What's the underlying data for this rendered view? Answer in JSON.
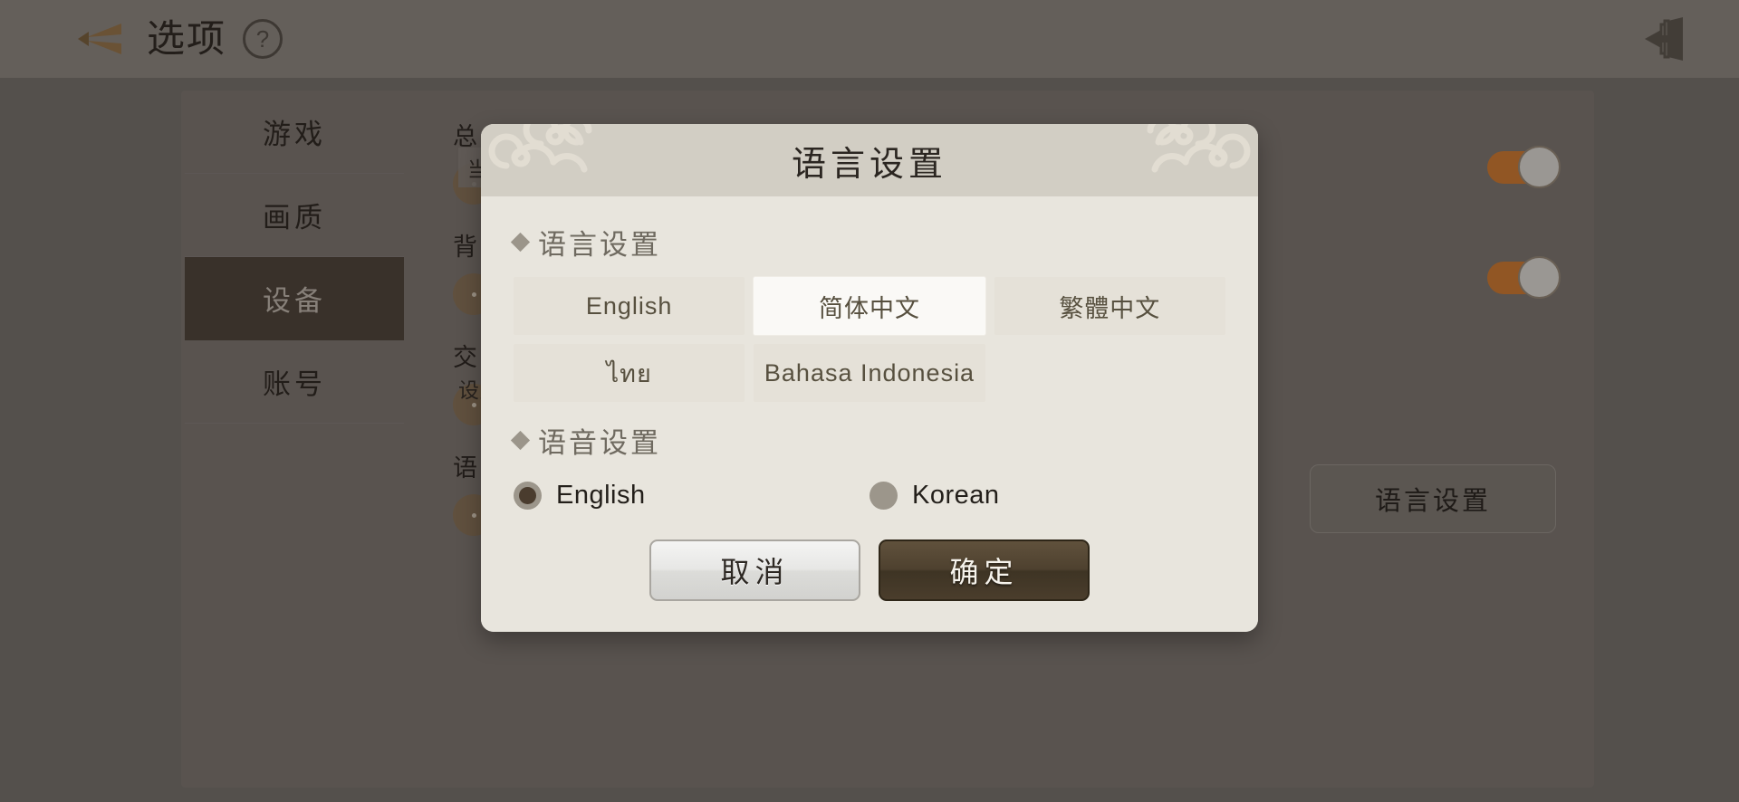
{
  "header": {
    "title": "选项",
    "back_icon": "back-arrow-icon",
    "help_icon": "help-question-icon",
    "exit_icon": "exit-door-icon"
  },
  "sidebar": {
    "items": [
      {
        "label": "游戏",
        "active": false
      },
      {
        "label": "画质",
        "active": false
      },
      {
        "label": "设备",
        "active": true
      },
      {
        "label": "账号",
        "active": false
      }
    ]
  },
  "background_settings": {
    "hidden_labels": [
      "总",
      "背",
      "交",
      "语"
    ],
    "rows": [
      {
        "desc": "当前设备的通知。",
        "toggle_on": true
      },
      {
        "desc": "",
        "toggle_on": true
      },
      {
        "desc": "设置会自动保存。",
        "toggle_on": false
      },
      {
        "button_label": "语言设置"
      }
    ]
  },
  "dialog": {
    "title": "语言设置",
    "language_section": {
      "heading": "语言设置",
      "options": [
        {
          "label": "English",
          "selected": false
        },
        {
          "label": "简体中文",
          "selected": true
        },
        {
          "label": "繁體中文",
          "selected": false
        },
        {
          "label": "ไทย",
          "selected": false
        },
        {
          "label": "Bahasa Indonesia",
          "selected": false
        }
      ]
    },
    "voice_section": {
      "heading": "语音设置",
      "options": [
        {
          "label": "English",
          "selected": true
        },
        {
          "label": "Korean",
          "selected": false
        }
      ]
    },
    "buttons": {
      "cancel": "取消",
      "confirm": "确定"
    }
  },
  "colors": {
    "accent_orange": "#c2702a",
    "confirm_brown": "#4e412f",
    "dialog_bg": "#e8e5dd",
    "dialog_header": "#d2cec4",
    "sidebar_active": "#443c33"
  }
}
